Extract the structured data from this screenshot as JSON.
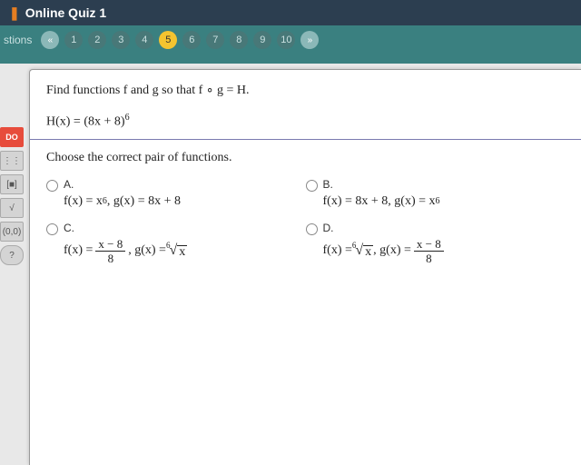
{
  "header": {
    "title": "Online Quiz 1"
  },
  "nav": {
    "label": "stions",
    "prev": "«",
    "next": "»",
    "items": [
      "1",
      "2",
      "3",
      "4",
      "5",
      "6",
      "7",
      "8",
      "9",
      "10"
    ],
    "active": "5"
  },
  "tools": {
    "do": "DO",
    "calc": "⋮⋮",
    "bracket": "[■]",
    "sqrt": "√",
    "interval": "(0,0)",
    "help": "?"
  },
  "question": {
    "prompt": "Find functions f and g so that f ∘ g = H.",
    "hx_lhs": "H(x) = (8x + 8)",
    "hx_exp": "6",
    "choose": "Choose the correct pair of functions.",
    "opts": {
      "A": {
        "label": "A.",
        "text_pre": "f(x) = x",
        "text_exp": "6",
        "text_post": ", g(x) = 8x + 8"
      },
      "B": {
        "label": "B.",
        "text_pre": "f(x) = 8x + 8, g(x) = x",
        "text_exp": "6",
        "text_post": ""
      },
      "C": {
        "label": "C.",
        "fx": "f(x) = ",
        "frac_num": "x − 8",
        "frac_den": "8",
        "comma": ", g(x) = ",
        "root_idx": "6",
        "root_rad": "x"
      },
      "D": {
        "label": "D.",
        "fx": "f(x) = ",
        "root_idx": "6",
        "root_rad": "x",
        "comma": ", g(x) = ",
        "frac_num": "x − 8",
        "frac_den": "8"
      }
    }
  }
}
